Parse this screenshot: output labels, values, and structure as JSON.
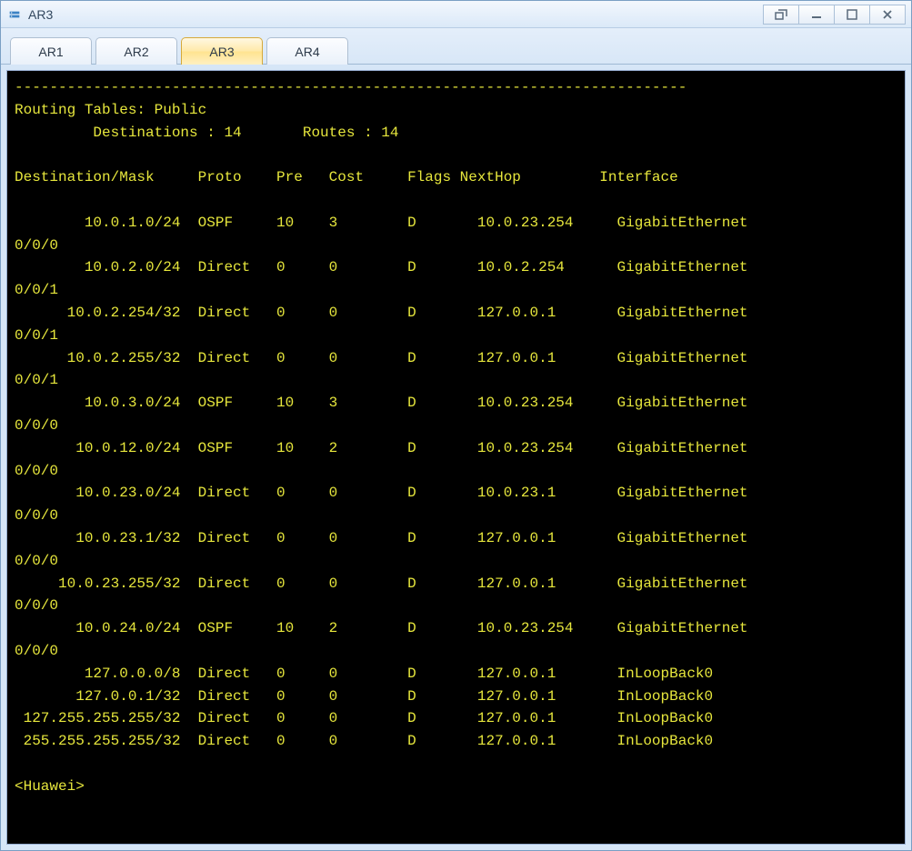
{
  "window": {
    "title": "AR3"
  },
  "tabs": [
    {
      "label": "AR1",
      "active": false
    },
    {
      "label": "AR2",
      "active": false
    },
    {
      "label": "AR3",
      "active": true
    },
    {
      "label": "AR4",
      "active": false
    }
  ],
  "terminal": {
    "separator": "-----------------------------------------------------------------------------",
    "table_title": "Routing Tables: Public",
    "summary_line": "         Destinations : 14       Routes : 14",
    "destinations_count": 14,
    "routes_count": 14,
    "columns": [
      "Destination/Mask",
      "Proto",
      "Pre",
      "Cost",
      "Flags",
      "NextHop",
      "Interface"
    ],
    "routes": [
      {
        "dest": "10.0.1.0/24",
        "proto": "OSPF",
        "pre": 10,
        "cost": 3,
        "flags": "D",
        "nexthop": "10.0.23.254",
        "iface": "GigabitEthernet0/0/0"
      },
      {
        "dest": "10.0.2.0/24",
        "proto": "Direct",
        "pre": 0,
        "cost": 0,
        "flags": "D",
        "nexthop": "10.0.2.254",
        "iface": "GigabitEthernet0/0/1"
      },
      {
        "dest": "10.0.2.254/32",
        "proto": "Direct",
        "pre": 0,
        "cost": 0,
        "flags": "D",
        "nexthop": "127.0.0.1",
        "iface": "GigabitEthernet0/0/1"
      },
      {
        "dest": "10.0.2.255/32",
        "proto": "Direct",
        "pre": 0,
        "cost": 0,
        "flags": "D",
        "nexthop": "127.0.0.1",
        "iface": "GigabitEthernet0/0/1"
      },
      {
        "dest": "10.0.3.0/24",
        "proto": "OSPF",
        "pre": 10,
        "cost": 3,
        "flags": "D",
        "nexthop": "10.0.23.254",
        "iface": "GigabitEthernet0/0/0"
      },
      {
        "dest": "10.0.12.0/24",
        "proto": "OSPF",
        "pre": 10,
        "cost": 2,
        "flags": "D",
        "nexthop": "10.0.23.254",
        "iface": "GigabitEthernet0/0/0"
      },
      {
        "dest": "10.0.23.0/24",
        "proto": "Direct",
        "pre": 0,
        "cost": 0,
        "flags": "D",
        "nexthop": "10.0.23.1",
        "iface": "GigabitEthernet0/0/0"
      },
      {
        "dest": "10.0.23.1/32",
        "proto": "Direct",
        "pre": 0,
        "cost": 0,
        "flags": "D",
        "nexthop": "127.0.0.1",
        "iface": "GigabitEthernet0/0/0"
      },
      {
        "dest": "10.0.23.255/32",
        "proto": "Direct",
        "pre": 0,
        "cost": 0,
        "flags": "D",
        "nexthop": "127.0.0.1",
        "iface": "GigabitEthernet0/0/0"
      },
      {
        "dest": "10.0.24.0/24",
        "proto": "OSPF",
        "pre": 10,
        "cost": 2,
        "flags": "D",
        "nexthop": "10.0.23.254",
        "iface": "GigabitEthernet0/0/0"
      },
      {
        "dest": "127.0.0.0/8",
        "proto": "Direct",
        "pre": 0,
        "cost": 0,
        "flags": "D",
        "nexthop": "127.0.0.1",
        "iface": "InLoopBack0"
      },
      {
        "dest": "127.0.0.1/32",
        "proto": "Direct",
        "pre": 0,
        "cost": 0,
        "flags": "D",
        "nexthop": "127.0.0.1",
        "iface": "InLoopBack0"
      },
      {
        "dest": "127.255.255.255/32",
        "proto": "Direct",
        "pre": 0,
        "cost": 0,
        "flags": "D",
        "nexthop": "127.0.0.1",
        "iface": "InLoopBack0"
      },
      {
        "dest": "255.255.255.255/32",
        "proto": "Direct",
        "pre": 0,
        "cost": 0,
        "flags": "D",
        "nexthop": "127.0.0.1",
        "iface": "InLoopBack0"
      }
    ],
    "prompt": "<Huawei>"
  },
  "column_widths": {
    "dest": 19,
    "proto": 9,
    "pre": 6,
    "cost": 9,
    "flags": 6,
    "nexthop": 16
  },
  "wrap_iface_at": 15
}
